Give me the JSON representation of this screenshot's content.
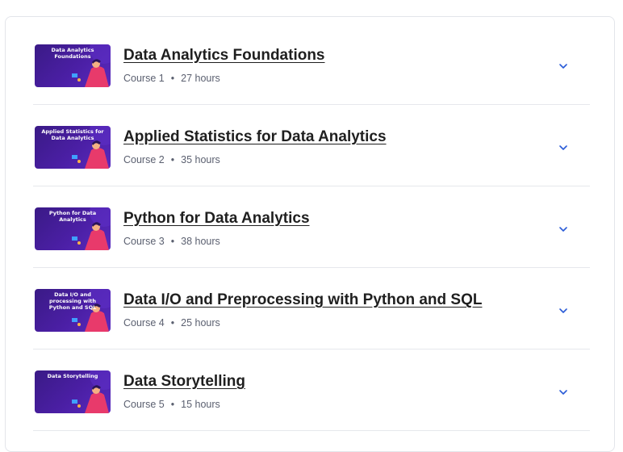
{
  "courses": [
    {
      "thumbnail_text": "Data Analytics Foundations",
      "title": "Data Analytics Foundations",
      "course_label": "Course 1",
      "separator": "•",
      "duration": "27 hours"
    },
    {
      "thumbnail_text": "Applied Statistics for Data Analytics",
      "title": "Applied Statistics for Data Analytics",
      "course_label": "Course 2",
      "separator": "•",
      "duration": "35 hours"
    },
    {
      "thumbnail_text": "Python for Data Analytics",
      "title": "Python for Data Analytics",
      "course_label": "Course 3",
      "separator": "•",
      "duration": "38 hours"
    },
    {
      "thumbnail_text": "Data I/O and processing with Python and SQL",
      "title": "Data I/O and Preprocessing with Python and SQL",
      "course_label": "Course 4",
      "separator": "•",
      "duration": "25 hours"
    },
    {
      "thumbnail_text": "Data Storytelling",
      "title": "Data Storytelling",
      "course_label": "Course 5",
      "separator": "•",
      "duration": "15 hours"
    }
  ],
  "colors": {
    "thumbnail_bg": "#4b1fa5",
    "title": "#1f1f1f",
    "meta": "#5b6070",
    "chevron": "#2a5bd7"
  },
  "icons": {
    "expand": "chevron-down-icon"
  }
}
